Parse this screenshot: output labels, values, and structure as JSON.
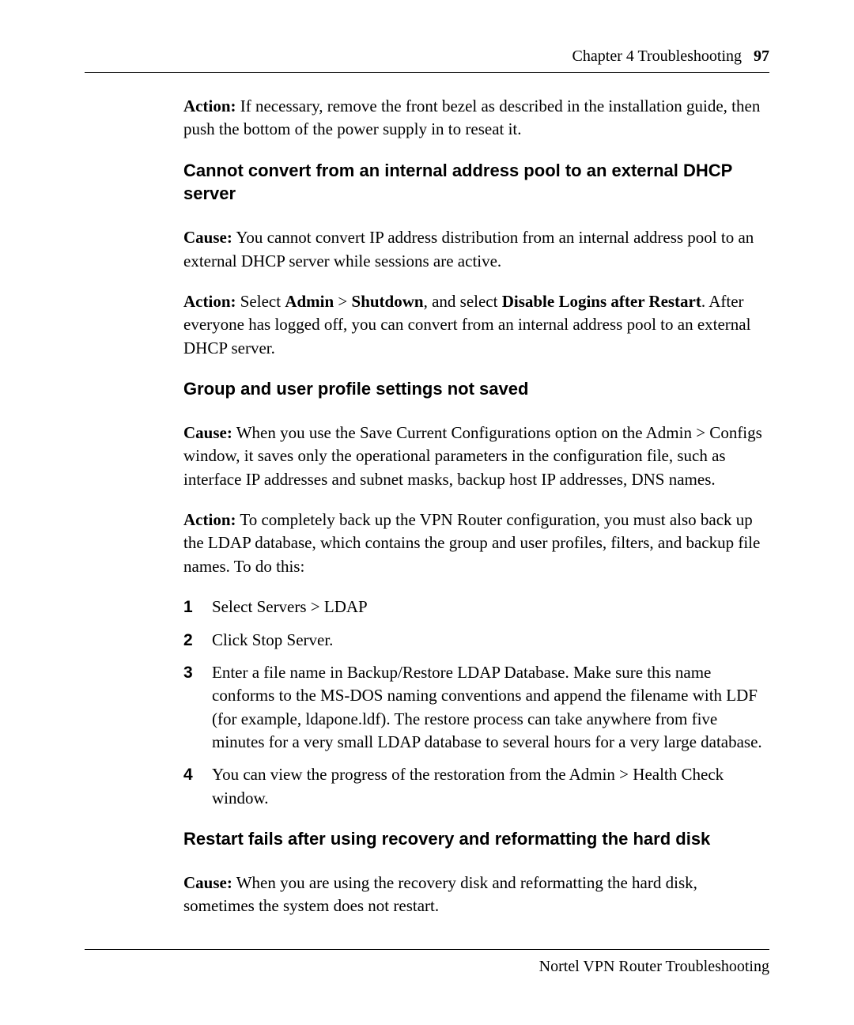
{
  "header": {
    "chapter": "Chapter 4   Troubleshooting",
    "page_number": "97"
  },
  "intro_para": {
    "label": "Action:",
    "text": " If necessary, remove the front bezel as described in the installation guide, then push the bottom of the power supply in to reseat it."
  },
  "section1": {
    "heading": "Cannot convert from an internal address pool to an external DHCP server",
    "cause_label": "Cause:",
    "cause_text": " You cannot convert IP address distribution from an internal address pool to an external DHCP server while sessions are active.",
    "action_label": "Action:",
    "action_pre": " Select ",
    "admin": "Admin",
    "sep1": "  > ",
    "shutdown": "Shutdown",
    "mid": ", and select ",
    "disable": "Disable Logins after Restart",
    "post": ". After everyone has logged off, you can convert from an internal address pool to an external DHCP server."
  },
  "section2": {
    "heading": "Group and user profile settings not saved",
    "cause_label": "Cause:",
    "cause_text": " When you use the Save Current Configurations option on the Admin > Configs window, it saves only the operational parameters in the configuration file, such as interface IP addresses and subnet masks, backup host IP addresses, DNS names.",
    "action_label": "Action:",
    "action_text": " To completely back up the VPN Router configuration, you must also back up the LDAP database, which contains the group and user profiles, filters, and backup file names. To do this:",
    "steps": [
      {
        "num": "1",
        "pre": "Select ",
        "b1": "Servers",
        "mid": " > ",
        "b2": "LDAP",
        "post": ""
      },
      {
        "num": "2",
        "pre": "Click ",
        "b1": "Stop Server",
        "mid": "",
        "b2": "",
        "post": "."
      },
      {
        "num": "3",
        "pre": "Enter a file name in ",
        "b1": "Backup/Restore LDAP Database",
        "mid": "",
        "b2": "",
        "post": ". Make sure this name conforms to the MS-DOS naming conventions and append the filename with LDF (for example, ldapone.ldf). The restore process can take anywhere from five minutes for a very small LDAP database to several hours for a very large database."
      },
      {
        "num": "4",
        "pre": "You can view the progress of the restoration from the Admin > Health Check window.",
        "b1": "",
        "mid": "",
        "b2": "",
        "post": ""
      }
    ]
  },
  "section3": {
    "heading": "Restart fails after using recovery and reformatting the hard disk",
    "cause_label": "Cause:",
    "cause_text": " When you are using the recovery disk and reformatting the hard disk, sometimes the system does not restart."
  },
  "footer": {
    "text": "Nortel VPN Router Troubleshooting"
  }
}
